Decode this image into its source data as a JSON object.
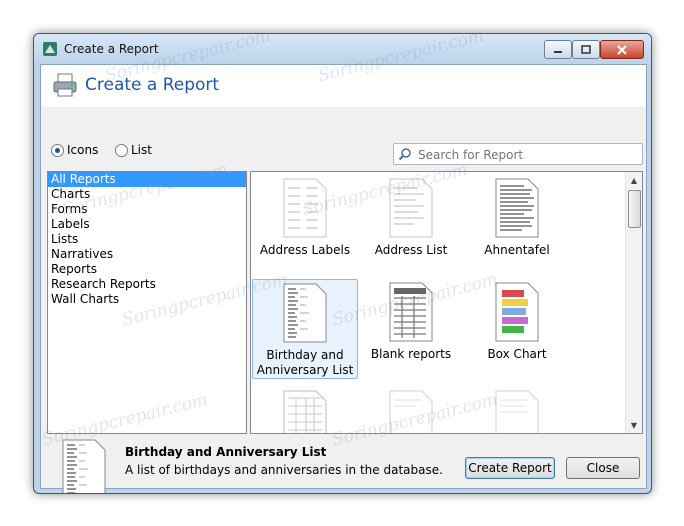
{
  "window": {
    "title": "Create a Report"
  },
  "header": {
    "title": "Create a Report"
  },
  "view_options": {
    "icons_label": "Icons",
    "list_label": "List",
    "selected": "Icons"
  },
  "search": {
    "placeholder": "Search for Report"
  },
  "categories": [
    {
      "label": "All Reports",
      "selected": true
    },
    {
      "label": "Charts"
    },
    {
      "label": "Forms"
    },
    {
      "label": "Labels"
    },
    {
      "label": "Lists"
    },
    {
      "label": "Narratives"
    },
    {
      "label": "Reports"
    },
    {
      "label": "Research Reports"
    },
    {
      "label": "Wall Charts"
    }
  ],
  "reports": [
    {
      "label": "Address Labels"
    },
    {
      "label": "Address List"
    },
    {
      "label": "Ahnentafel"
    },
    {
      "label": "Birthday and Anniversary List",
      "selected": true
    },
    {
      "label": "Blank reports"
    },
    {
      "label": "Box Chart"
    }
  ],
  "details": {
    "title": "Birthday and Anniversary List",
    "description": "A list of birthdays and anniversaries in the database."
  },
  "buttons": {
    "create": "Create Report",
    "close": "Close"
  },
  "watermark": "Soringpcrepair.com"
}
